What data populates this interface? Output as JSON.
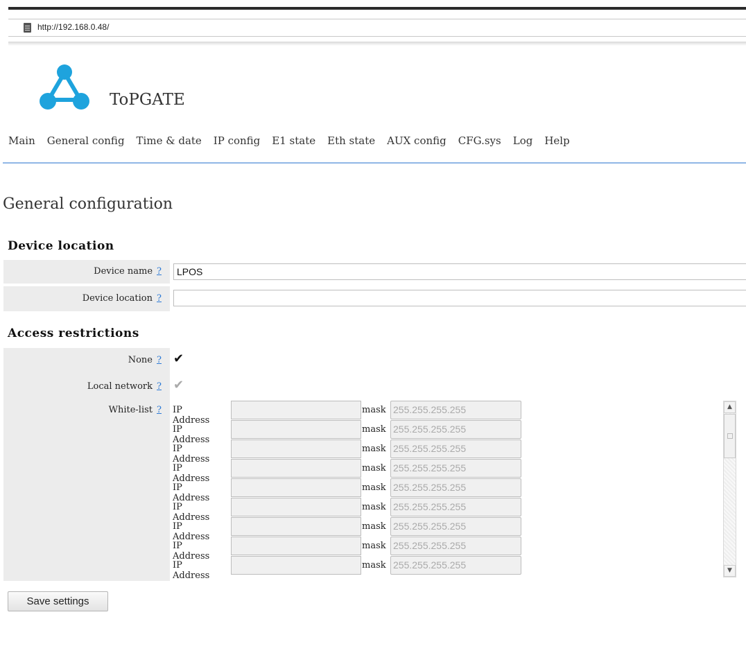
{
  "browser": {
    "url": "http://192.168.0.48/"
  },
  "brand": {
    "name": "ToPGATE"
  },
  "nav": {
    "items": [
      "Main",
      "General config",
      "Time & date",
      "IP config",
      "E1 state",
      "Eth state",
      "AUX config",
      "CFG.sys",
      "Log",
      "Help"
    ]
  },
  "page": {
    "title": "General configuration"
  },
  "device_location": {
    "heading": "Device location",
    "name_label": "Device name",
    "name_value": "LPOS",
    "location_label": "Device location",
    "location_value": ""
  },
  "access": {
    "heading": "Access restrictions",
    "none_label": "None",
    "none_checked": true,
    "local_label": "Local network",
    "local_checked": true,
    "whitelist_label": "White-list",
    "help": "?",
    "rows": [
      {
        "ip_label": "IP Address",
        "ip": "",
        "mask_label": "mask",
        "mask": "255.255.255.255"
      },
      {
        "ip_label": "IP Address",
        "ip": "",
        "mask_label": "mask",
        "mask": "255.255.255.255"
      },
      {
        "ip_label": "IP Address",
        "ip": "",
        "mask_label": "mask",
        "mask": "255.255.255.255"
      },
      {
        "ip_label": "IP Address",
        "ip": "",
        "mask_label": "mask",
        "mask": "255.255.255.255"
      },
      {
        "ip_label": "IP Address",
        "ip": "",
        "mask_label": "mask",
        "mask": "255.255.255.255"
      },
      {
        "ip_label": "IP Address",
        "ip": "",
        "mask_label": "mask",
        "mask": "255.255.255.255"
      },
      {
        "ip_label": "IP Address",
        "ip": "",
        "mask_label": "mask",
        "mask": "255.255.255.255"
      },
      {
        "ip_label": "IP Address",
        "ip": "",
        "mask_label": "mask",
        "mask": "255.255.255.255"
      },
      {
        "ip_label": "IP Address",
        "ip": "",
        "mask_label": "mask",
        "mask": "255.255.255.255"
      }
    ]
  },
  "actions": {
    "save_label": "Save settings"
  },
  "colors": {
    "accent_line": "#8fb6e6",
    "help_link": "#2b79d6",
    "label_bg": "#ececec",
    "logo": "#1ea3dd"
  }
}
